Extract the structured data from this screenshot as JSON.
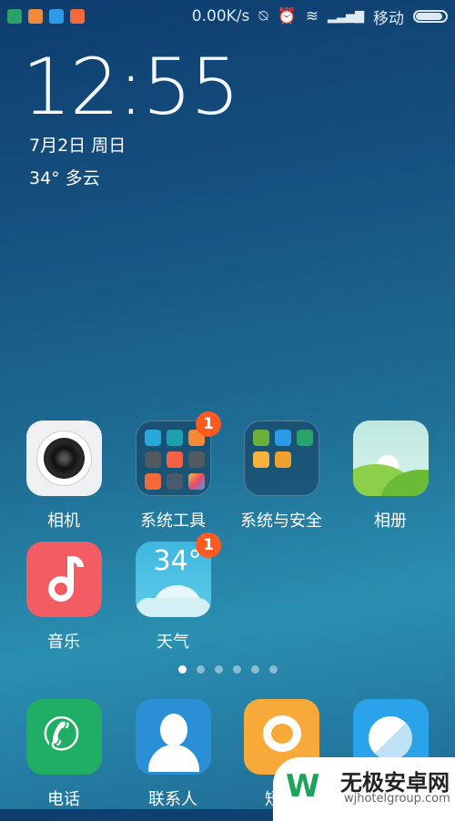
{
  "status_bar": {
    "notifications": [
      "security-icon",
      "music-icon",
      "browser-icon",
      "mi-store-icon"
    ],
    "net_speed": "0.00K/s",
    "carrier": "移动",
    "battery_percent": 90
  },
  "lockclock": {
    "time": "12:55",
    "date": "7月2日 周日",
    "weather": "34° 多云"
  },
  "apps": [
    {
      "label": "相机",
      "icon": "camera-icon"
    },
    {
      "label": "系统工具",
      "icon": "folder-icon",
      "badge": "1"
    },
    {
      "label": "系统与安全",
      "icon": "folder-icon"
    },
    {
      "label": "相册",
      "icon": "gallery-icon"
    },
    {
      "label": "音乐",
      "icon": "music-icon"
    },
    {
      "label": "天气",
      "icon": "weather-icon",
      "badge": "1",
      "temp": "34°"
    }
  ],
  "page_indicator": {
    "pages": 6,
    "current": 1
  },
  "dock": [
    {
      "label": "电话",
      "icon": "phone-icon"
    },
    {
      "label": "联系人",
      "icon": "contacts-icon"
    },
    {
      "label": "短信",
      "icon": "messages-icon"
    },
    {
      "label": "",
      "icon": "browser-icon"
    }
  ],
  "watermark": {
    "title": "无极安卓网",
    "url": "wjhotelgroup.com"
  }
}
